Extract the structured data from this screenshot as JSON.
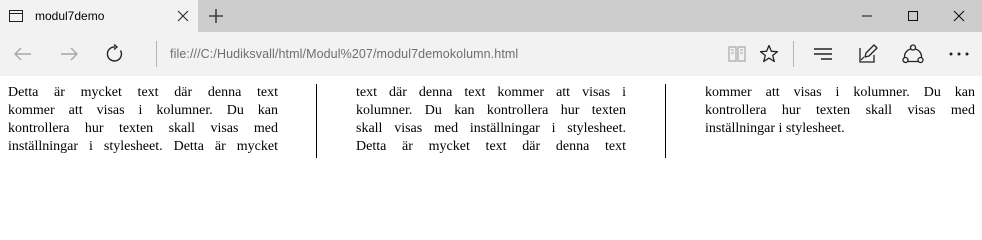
{
  "tab": {
    "title": "modul7demo"
  },
  "address": {
    "url": "file:///C:/Hudiksvall/html/Modul%207/modul7demokolumn.html"
  },
  "columns": [
    {
      "lines": [
        "Detta är mycket text där denna text",
        "kommer att visas i kolumner. Du kan",
        "kontrollera hur texten skall visas med",
        "inställningar i stylesheet. Detta är mycket"
      ]
    },
    {
      "lines": [
        "text där denna text kommer att visas i",
        "kolumner. Du kan kontrollera hur texten",
        "skall visas med inställningar i stylesheet.",
        "Detta är mycket text där denna text"
      ]
    },
    {
      "lines": [
        "kommer att visas i kolumner. Du kan",
        "kontrollera hur texten skall visas med",
        "inställningar i stylesheet."
      ]
    }
  ],
  "icons": {
    "tab": "window-icon",
    "close": "close-icon",
    "new_tab": "plus-icon",
    "back": "back-arrow-icon",
    "forward": "forward-arrow-icon",
    "refresh": "refresh-icon",
    "reading_view": "book-icon",
    "favorite": "star-icon",
    "hub": "hub-icon",
    "notes": "pen-icon",
    "share": "share-icon",
    "more": "more-icon"
  }
}
